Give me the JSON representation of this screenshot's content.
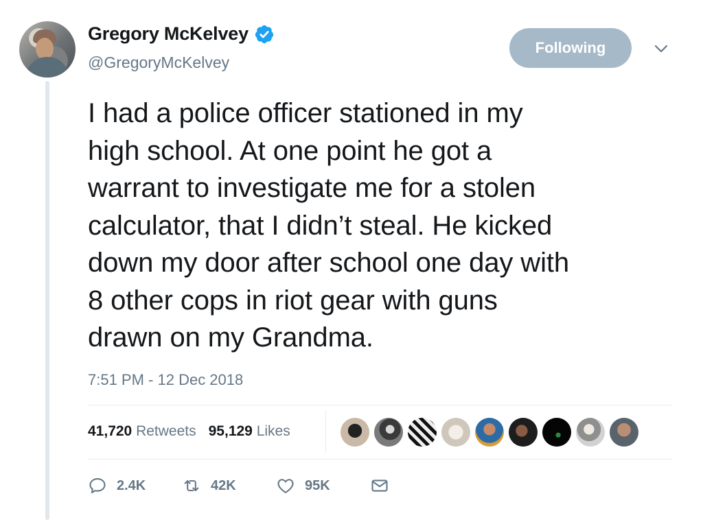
{
  "tweet": {
    "author": {
      "display_name": "Gregory McKelvey",
      "handle": "@GregoryMcKelvey",
      "verified": true
    },
    "follow_button_label": "Following",
    "text": "I had a police officer stationed in my\nhigh school. At one point he got a\nwarrant to investigate me for a stolen\ncalculator, that I didn’t steal. He kicked\ndown my door after school one day with\n8 other cops in riot gear with guns\ndrawn on my Grandma.",
    "timestamp": "7:51 PM - 12 Dec 2018",
    "stats": {
      "retweets_count": "41,720",
      "retweets_label": "Retweets",
      "likes_count": "95,129",
      "likes_label": "Likes"
    },
    "actions": {
      "replies": "2.4K",
      "retweets": "42K",
      "likes": "95K"
    }
  },
  "colors": {
    "verified": "#1da1f2",
    "follow_button_bg": "#a6b9c8",
    "secondary_text": "#657786",
    "primary_text": "#14171a"
  },
  "icons": [
    "verified-badge-icon",
    "chevron-down-icon",
    "reply-icon",
    "retweet-icon",
    "like-icon",
    "direct-message-icon"
  ]
}
